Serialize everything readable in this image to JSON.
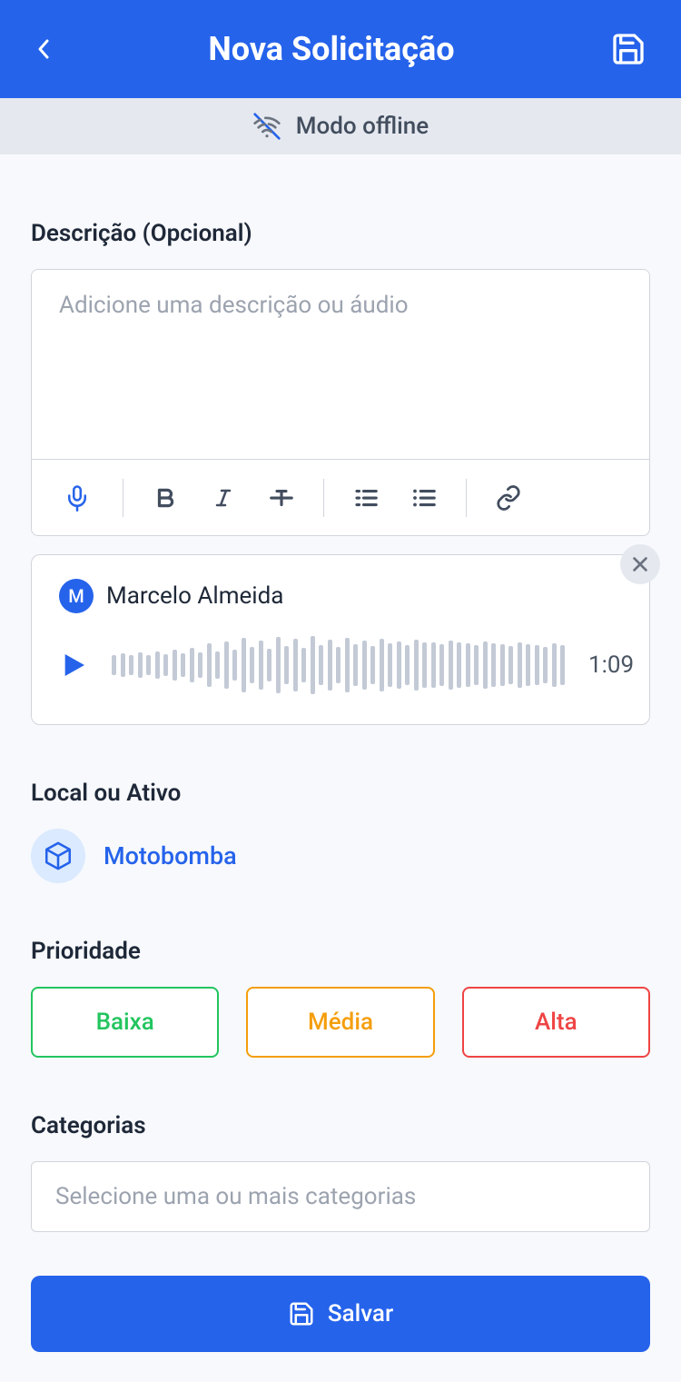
{
  "header": {
    "title": "Nova Solicitação"
  },
  "offline": {
    "label": "Modo offline"
  },
  "description": {
    "label": "Descrição (Opcional)",
    "placeholder": "Adicione uma descrição ou áudio",
    "value": ""
  },
  "audio": {
    "author_initial": "M",
    "author_name": "Marcelo Almeida",
    "duration": "1:09"
  },
  "location": {
    "label": "Local ou Ativo",
    "asset_name": "Motobomba"
  },
  "priority": {
    "label": "Prioridade",
    "options": {
      "low": "Baixa",
      "medium": "Média",
      "high": "Alta"
    }
  },
  "categories": {
    "label": "Categorias",
    "placeholder": "Selecione uma ou mais categorias"
  },
  "save": {
    "label": "Salvar"
  },
  "colors": {
    "primary": "#2563eb",
    "low": "#22c55e",
    "medium": "#f59e0b",
    "high": "#ef4444"
  }
}
